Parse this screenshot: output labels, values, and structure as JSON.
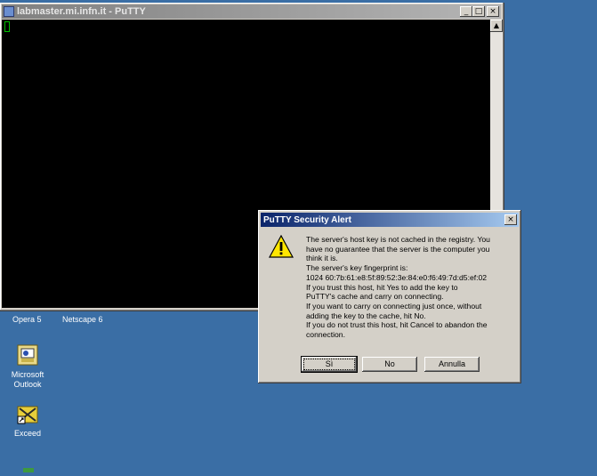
{
  "putty": {
    "title": "labmaster.mi.infn.it - PuTTY",
    "minimize_symbol": "_",
    "maximize_symbol": "□",
    "close_symbol": "×",
    "scroll_up_symbol": "▲"
  },
  "desktop": {
    "icons": [
      {
        "label": "Opera 5"
      },
      {
        "label": "Netscape 6"
      },
      {
        "label_line1": "Microsoft",
        "label_line2": "Outlook"
      },
      {
        "label": "Exceed"
      }
    ]
  },
  "dialog": {
    "title": "PuTTY Security Alert",
    "close_symbol": "×",
    "message_lines": [
      "The server's host key is not cached in the registry. You",
      "have no guarantee that the server is the computer you",
      "think it is.",
      "The server's key fingerprint is:",
      "1024 60:7b:61:e8:5f:89:52:3e:84:e0:f6:49:7d:d5:ef:02",
      "If you trust this host, hit Yes to add the key to",
      "PuTTY's cache and carry on connecting.",
      "If you want to carry on connecting just once, without",
      "adding the key to the cache, hit No.",
      "If you do not trust this host, hit Cancel to abandon the",
      "connection."
    ],
    "buttons": {
      "yes": "Sì",
      "no": "No",
      "cancel": "Annulla"
    }
  }
}
